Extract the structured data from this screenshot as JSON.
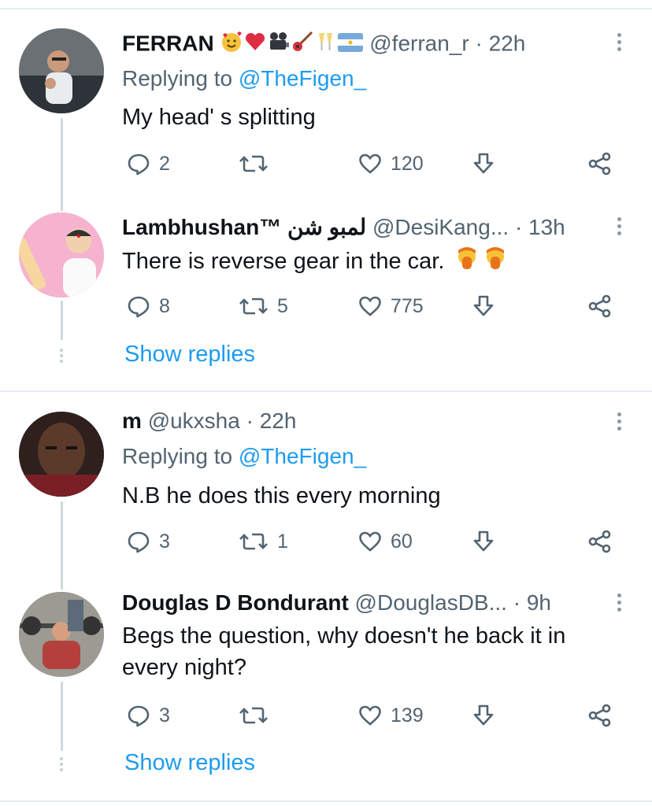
{
  "tweets": [
    {
      "name": "FERRAN",
      "handle": "@ferran_r",
      "time": "· 22h",
      "replying_label": "Replying to",
      "replying_to": "@TheFigen_",
      "text": "My head' s splitting",
      "replies": "2",
      "retweets": "",
      "likes": "120"
    },
    {
      "name": "Lambhushan™ لمبو شن",
      "handle": "@DesiKang...",
      "time": "· 13h",
      "text": "There is reverse gear in the car.",
      "replies": "8",
      "retweets": "5",
      "likes": "775",
      "show_replies": "Show replies"
    },
    {
      "name": "m",
      "handle": "@ukxsha",
      "time": "· 22h",
      "replying_label": "Replying to",
      "replying_to": "@TheFigen_",
      "text": "N.B he does this every morning",
      "replies": "3",
      "retweets": "1",
      "likes": "60"
    },
    {
      "name": "Douglas D Bondurant",
      "handle": "@DouglasDB...",
      "time": "· 9h",
      "text_line1": "Begs the question, why doesn't he back it in",
      "text_line2": "every night?",
      "replies": "3",
      "retweets": "",
      "likes": "139",
      "show_replies": "Show replies"
    }
  ],
  "icons": [
    "reply-icon",
    "retweet-icon",
    "like-icon",
    "bookmark-icon",
    "share-icon",
    "more-icon"
  ],
  "colors": {
    "link": "#1d9bf0",
    "muted": "#536471",
    "text": "#0f1419",
    "separator": "#e6ecf0"
  }
}
